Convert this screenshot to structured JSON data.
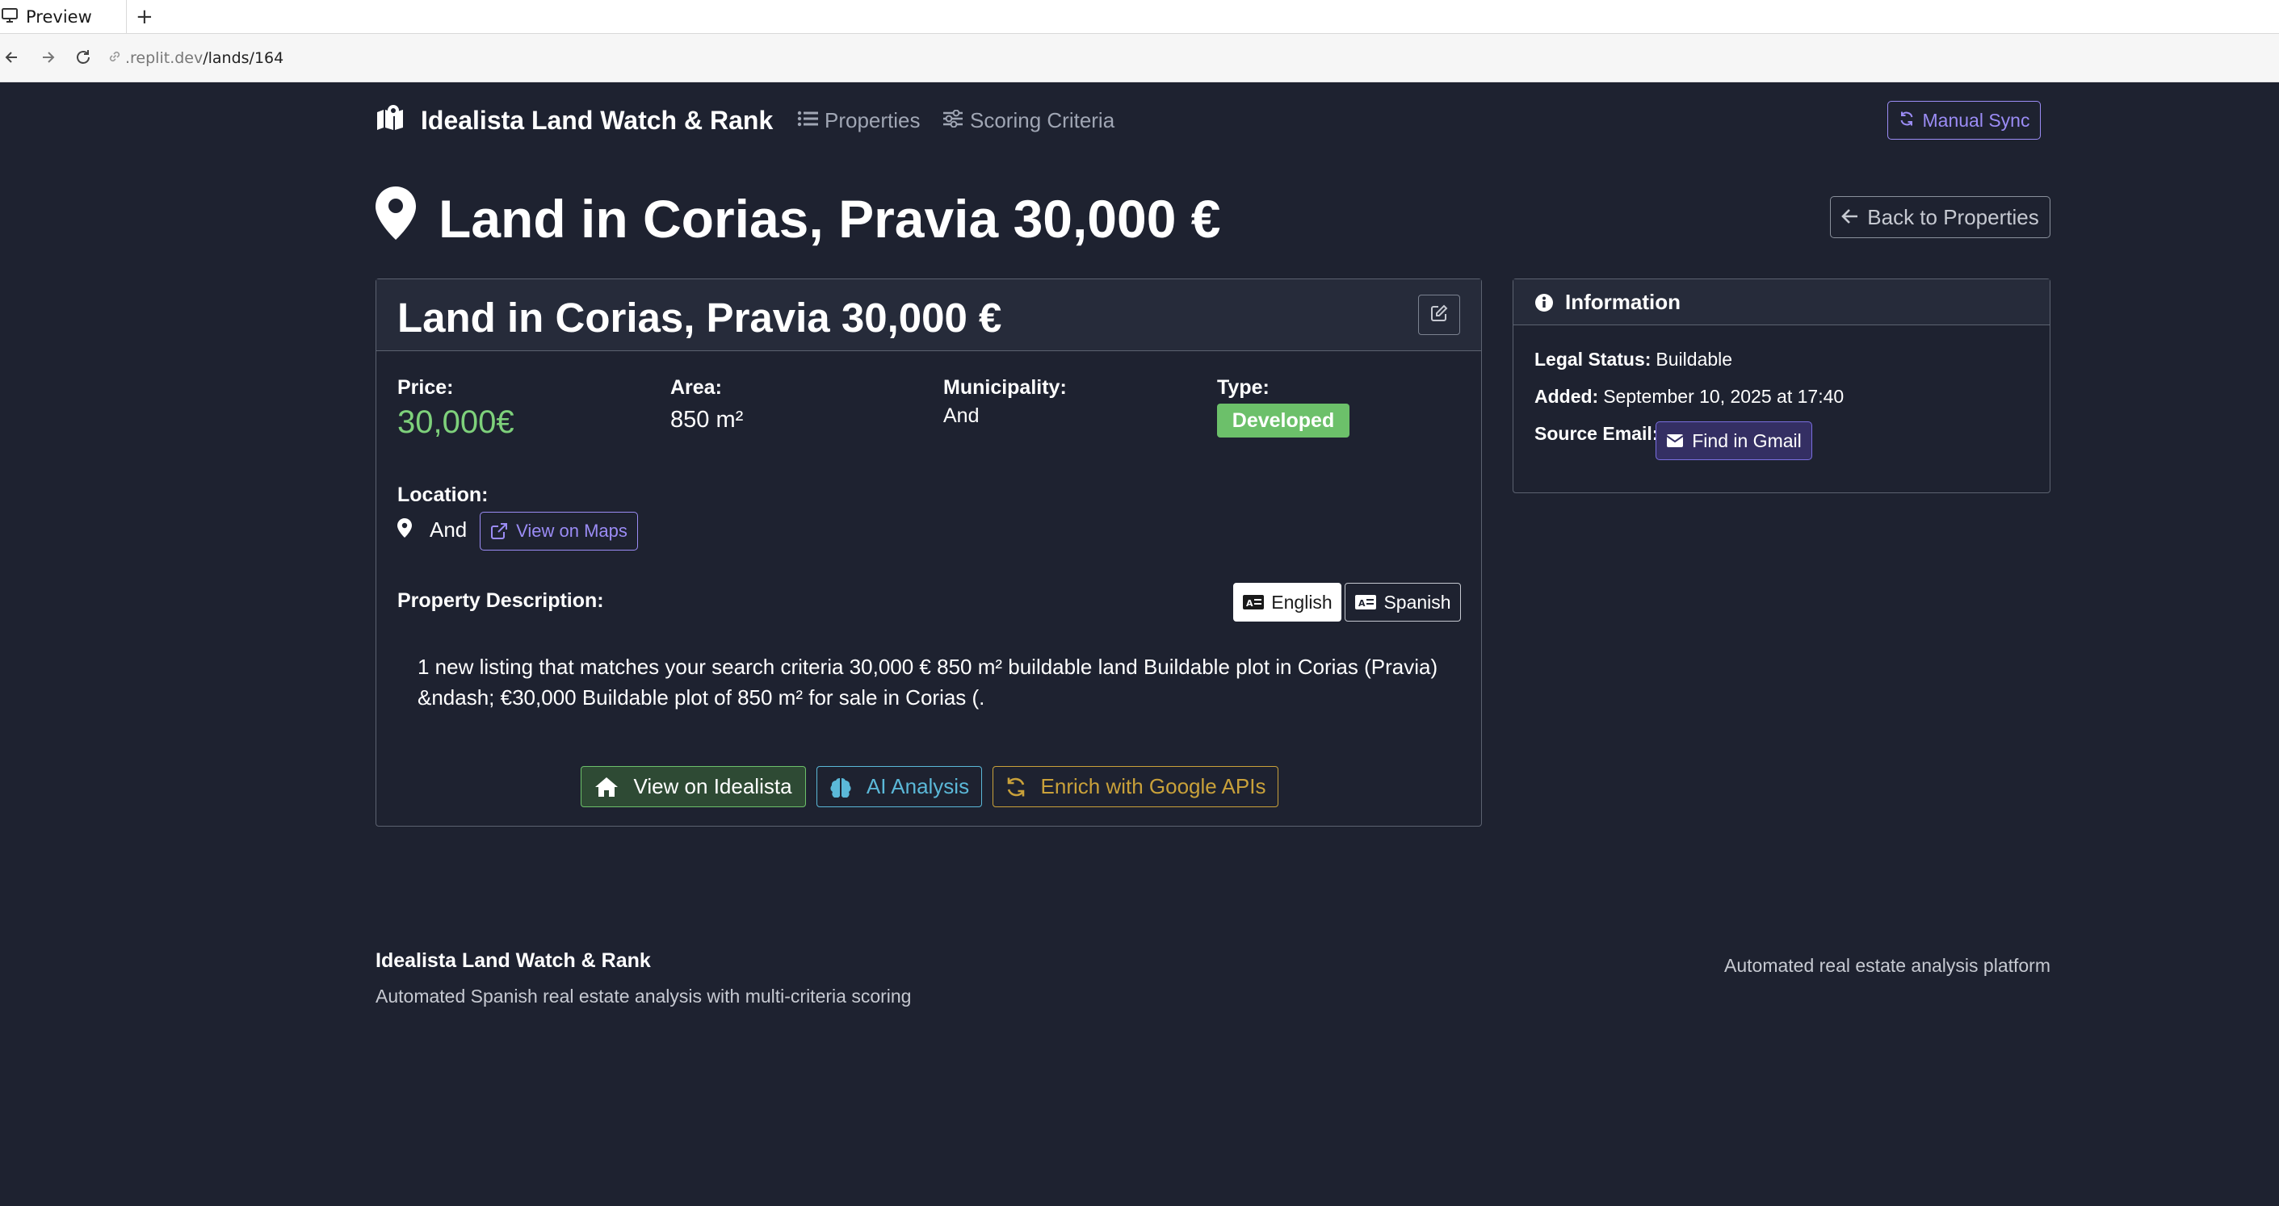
{
  "browser": {
    "tab_label": "Preview",
    "new_tab_symbol": "+",
    "url_host": ".replit.dev",
    "url_path": "/lands/164"
  },
  "navbar": {
    "brand": "Idealista Land Watch & Rank",
    "links": [
      {
        "label": "Properties",
        "icon": "list-icon"
      },
      {
        "label": "Scoring Criteria",
        "icon": "sliders-icon"
      }
    ],
    "sync_label": "Manual Sync"
  },
  "page": {
    "title": "Land in Corias, Pravia 30,000 €",
    "back_label": "Back to Properties"
  },
  "property": {
    "card_title": "Land in Corias, Pravia 30,000 €",
    "price_label": "Price:",
    "price_value": "30,000€",
    "area_label": "Area:",
    "area_value": "850 m²",
    "municipality_label": "Municipality:",
    "municipality_value": "And",
    "type_label": "Type:",
    "type_value": "Developed",
    "location_label": "Location:",
    "location_value": "And",
    "maps_label": "View on Maps",
    "description_label": "Property Description:",
    "lang_english": "English",
    "lang_spanish": "Spanish",
    "description_line1": "1 new listing that matches your search criteria 30,000 € 850 m² buildable land Buildable plot in Corias (Pravia)",
    "description_line2": "&ndash; €30,000 Buildable plot of 850 m² for sale in Corias (.",
    "actions": {
      "idealista": "View on Idealista",
      "ai": "AI Analysis",
      "enrich": "Enrich with Google APIs"
    }
  },
  "information": {
    "title": "Information",
    "legal_status_label": "Legal Status:",
    "legal_status_value": "Buildable",
    "added_label": "Added:",
    "added_value": "September 10, 2025 at 17:40",
    "source_email_label": "Source Email:",
    "gmail_label": "Find in Gmail"
  },
  "footer": {
    "title": "Idealista Land Watch & Rank",
    "subtitle": "Automated Spanish real estate analysis with multi-criteria scoring",
    "right_text": "Automated real estate analysis platform"
  },
  "colors": {
    "background": "#1e2230",
    "accent_purple": "#9b8cf5",
    "success_green": "#6cc06a",
    "info_blue": "#5bb8d8",
    "warning_gold": "#c9a13a"
  }
}
